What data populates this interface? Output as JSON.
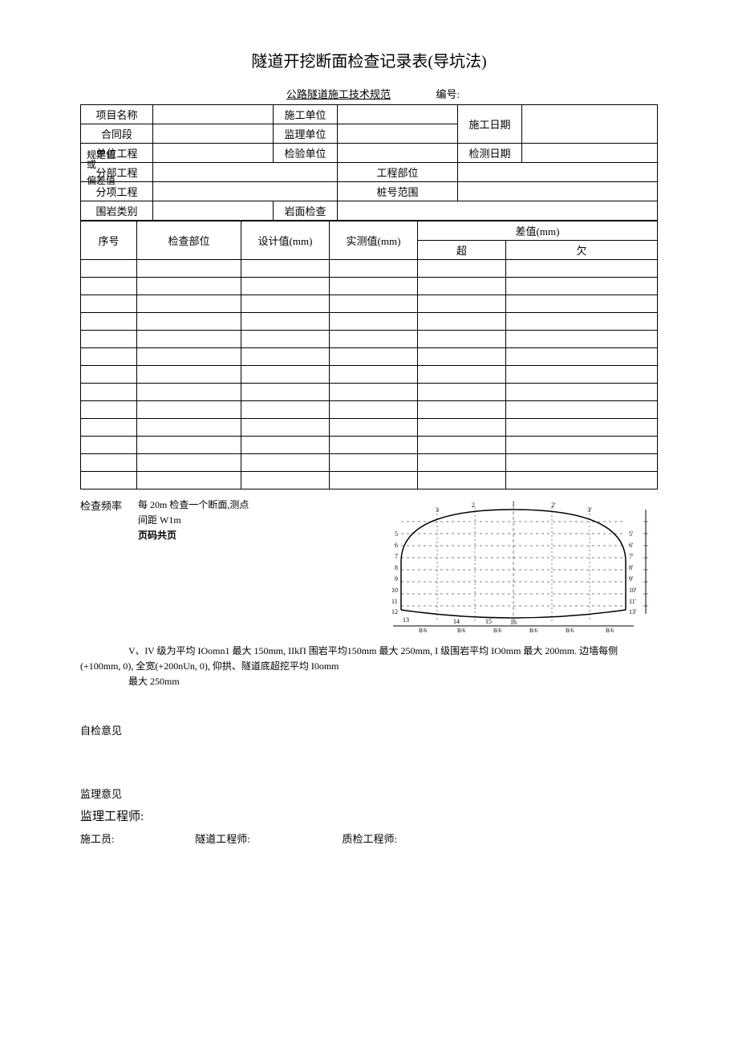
{
  "title": "隧道开挖断面检查记录表(导坑法)",
  "subtitle_spec": "公路隧道施工技术规范",
  "subtitle_no": "编号:",
  "header": {
    "project_name": "项目名称",
    "construction_unit": "施工单位",
    "construction_date": "施工日期",
    "contract_section": "合同段",
    "supervision_unit": "监理单位",
    "unit_project": "单位工程",
    "inspection_unit": "检验单位",
    "inspection_date": "检测日期",
    "sub_project": "分部工程",
    "project_part": "工程部位",
    "item_project": "分项工程",
    "stake_range": "桩号范围",
    "rock_type": "围岩类别",
    "rock_face": "岩面检查"
  },
  "overlay": {
    "guiding": "规定值",
    "or": "或",
    "deviation": "偏差值"
  },
  "cols": {
    "seq": "序号",
    "part": "检查部位",
    "design": "设计值(mm)",
    "measured": "实测值(mm)",
    "diff": "差值(mm)",
    "over": "超",
    "under": "欠"
  },
  "freq_label": "检查频率",
  "freq_text1": "每 20m 检查一个断面,测点",
  "freq_text2": "间距 W1m",
  "page_label": "页码共页",
  "spec_text": "V、lV 级为平均 IOomn1 最大 150mm, IIkΠ 围岩平均150mm 最大 250mm, I 级围岩平均 IO0mm 最大 200mm. 边墙每侧(+100mm, 0), 全宽(+200nUn, 0), 仰拱、隧道底超挖平均 I0omm",
  "spec_text2": "最大 250mm",
  "self_opinion": "自检意见",
  "sup_opinion": "监理意见",
  "sup_engineer": "监理工程师:",
  "sig1": "施工员:",
  "sig2": "隧道工程师:",
  "sig3": "质检工程师:"
}
